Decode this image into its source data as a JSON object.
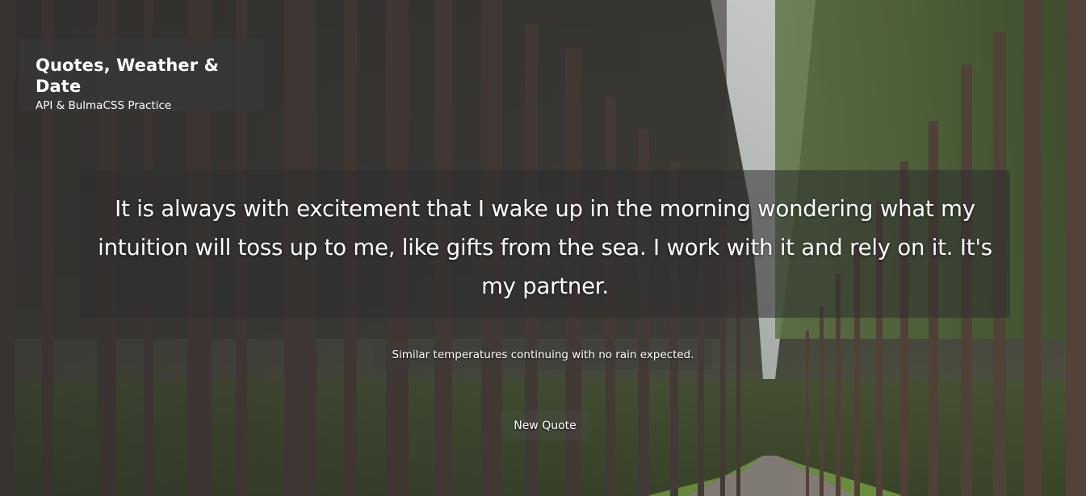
{
  "header": {
    "title": "Quotes, Weather & Date",
    "subtitle": "API & BulmaCSS Practice"
  },
  "quote": {
    "text": "It is always with excitement that I wake up in the morning wondering what my intuition will toss up to me, like gifts from the sea. I work with it and rely on it. It's my partner."
  },
  "weather": {
    "summary": "Similar temperatures continuing with no rain expected."
  },
  "actions": {
    "new_quote_label": "New Quote"
  },
  "background": {
    "scene": "forest-road-image",
    "colors": {
      "trunk": "#4a3d33",
      "canopy": "#3f5a2c",
      "sky": "#e9ecea",
      "road": "#8f8780",
      "grass": "#6f9a3c"
    }
  }
}
